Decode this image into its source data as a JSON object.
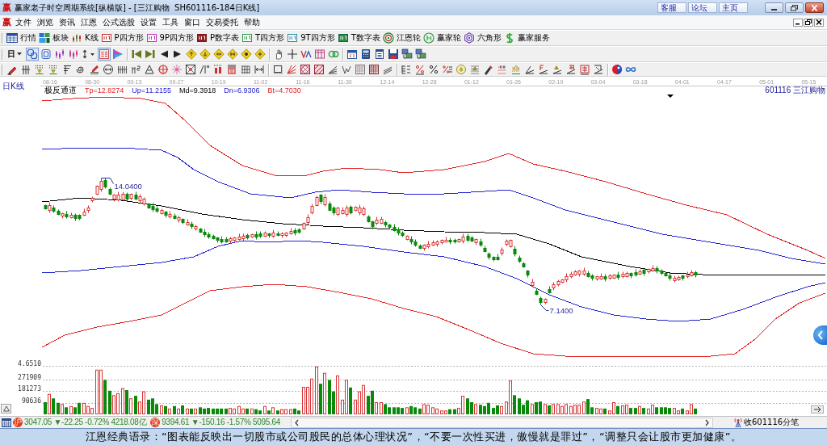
{
  "title_bar": {
    "logo": "赢",
    "title": "赢家老子时空周期系统[纵横版] - [三江购物  SH601116-184日K线]",
    "links": [
      "客服",
      "论坛",
      "主页"
    ]
  },
  "menu_bar": {
    "logo": "赢",
    "items": [
      "文件",
      "浏览",
      "资讯",
      "江恩",
      "公式选股",
      "设置",
      "工具",
      "窗口",
      "交易委托",
      "帮助"
    ]
  },
  "toolbar_1": {
    "items": [
      "行情",
      "板块",
      "K线",
      "P四方形",
      "9P四方形",
      "P数字表",
      "T四方形",
      "9T四方形",
      "T数字表",
      "江恩轮",
      "赢家轮",
      "六角形",
      "赢家服务"
    ]
  },
  "toolbar_2": {
    "period": "日",
    "buttons": [
      {
        "pressed": true
      },
      {
        "pressed": false
      },
      {
        "pressed": false
      },
      {
        "pressed": false
      },
      {
        "pressed": false
      },
      {
        "pressed": true
      },
      {
        "pressed": false
      },
      {
        "pressed": false
      },
      {
        "pressed": false
      },
      {
        "pressed": false
      },
      {
        "pressed": false
      },
      {
        "pressed": false
      },
      {
        "pressed": false
      },
      {
        "pressed": false
      },
      {
        "pressed": false
      },
      {
        "pressed": false
      },
      {
        "pressed": false
      },
      {
        "pressed": false
      },
      {
        "pressed": false
      },
      {
        "pressed": false
      },
      {
        "pressed": false
      },
      {
        "pressed": false
      },
      {
        "pressed": false
      },
      {
        "pressed": false
      },
      {
        "pressed": false
      },
      {
        "pressed": false
      },
      {
        "pressed": false
      },
      {
        "pressed": false
      }
    ]
  },
  "price_chart": {
    "period_label": "日K线",
    "dates": [
      "08-16",
      "08-30",
      "09-13",
      "09-27",
      "10-19",
      "11-02",
      "11-16",
      "11-30",
      "12-14",
      "12-28",
      "01-12",
      "01-26",
      "02-19",
      "03-04",
      "03-18",
      "04-01",
      "04-17",
      "05-01",
      "05-15"
    ],
    "indicator": {
      "name": "极反通道",
      "lines": [
        {
          "text": "Tp=12.8274",
          "color": "#e02020"
        },
        {
          "text": "Up=11.2155",
          "color": "#2020d0"
        },
        {
          "text": "Md=9.3918",
          "color": "#000000"
        },
        {
          "text": "Dn=6.9306",
          "color": "#2020d0"
        },
        {
          "text": "Bt=4.7030",
          "color": "#e02020"
        }
      ]
    },
    "stock_label": "601116 三江购物",
    "annotations": [
      {
        "kind": "high",
        "text": "14.0400"
      },
      {
        "kind": "low",
        "text": "7.1400"
      }
    ]
  },
  "volume_chart": {
    "top_label": "4.6510",
    "chart_data": {
      "type": "bar",
      "grid": true,
      "ylim": [
        0,
        382000
      ],
      "yticks": [
        90636,
        181273,
        271909
      ],
      "values": [
        95000,
        160000,
        125000,
        90000,
        80000,
        55000,
        65000,
        55000,
        90000,
        90000,
        65000,
        50000,
        350000,
        350000,
        270000,
        185000,
        150000,
        165000,
        205000,
        190000,
        125000,
        145000,
        100000,
        180000,
        115000,
        125000,
        80000,
        70000,
        65000,
        45000,
        65000,
        45000,
        70000,
        45000,
        45000,
        45000,
        55000,
        45000,
        50000,
        45000,
        45000,
        45000,
        45000,
        50000,
        45000,
        65000,
        45000,
        45000,
        45000,
        40000,
        30000,
        65000,
        30000,
        55000,
        30000,
        40000,
        40000,
        40000,
        45000,
        30000,
        215000,
        215000,
        280000,
        375000,
        240000,
        325000,
        270000,
        180000,
        305000,
        115000,
        270000,
        210000,
        115000,
        180000,
        230000,
        145000,
        185000,
        95000,
        95000,
        80000,
        55000,
        55000,
        55000,
        50000,
        55000,
        65000,
        55000,
        45000,
        80000,
        75000,
        55000,
        45000,
        30000,
        30000,
        40000,
        40000,
        50000,
        145000,
        125000,
        95000,
        80000,
        75000,
        65000,
        90000,
        50000,
        70000,
        65000,
        100000,
        265000,
        150000,
        125000,
        75000,
        110000,
        80000,
        95000,
        100000,
        80000,
        70000,
        80000,
        80000,
        65000,
        80000,
        65000,
        75000,
        75000,
        100000,
        120000,
        55000,
        50000,
        45000,
        45000,
        30000,
        95000,
        65000,
        70000,
        75000,
        50000,
        50000,
        65000,
        50000,
        45000,
        75000,
        55000,
        55000,
        55000,
        50000,
        50000,
        30000,
        45000,
        30000,
        80000,
        45000,
        null,
        null,
        null,
        null,
        null,
        null,
        null,
        null,
        null,
        null,
        null,
        null,
        null,
        null,
        null,
        null,
        null,
        null,
        null,
        null,
        null,
        null,
        null,
        null,
        null,
        null,
        null,
        null,
        null,
        null
      ]
    },
    "bars": [
      {
        "rising": false
      },
      {
        "rising": true
      },
      {
        "rising": false
      },
      {
        "rising": false
      },
      {
        "rising": true
      },
      {
        "rising": false
      },
      {
        "rising": true
      },
      {
        "rising": false
      },
      {
        "rising": false
      },
      {
        "rising": true
      },
      {
        "rising": true
      },
      {
        "rising": true
      },
      {
        "rising": true
      },
      {
        "rising": true
      },
      {
        "rising": false
      },
      {
        "rising": false
      },
      {
        "rising": true
      },
      {
        "rising": true
      },
      {
        "rising": true
      },
      {
        "rising": false
      },
      {
        "rising": true
      },
      {
        "rising": false
      },
      {
        "rising": true
      },
      {
        "rising": true
      },
      {
        "rising": false
      },
      {
        "rising": false
      },
      {
        "rising": false
      },
      {
        "rising": true
      },
      {
        "rising": false
      },
      {
        "rising": true
      },
      {
        "rising": false
      },
      {
        "rising": true
      },
      {
        "rising": false
      },
      {
        "rising": true
      },
      {
        "rising": false
      },
      {
        "rising": true
      },
      {
        "rising": false
      },
      {
        "rising": false
      },
      {
        "rising": false
      },
      {
        "rising": false
      },
      {
        "rising": false
      },
      {
        "rising": false
      },
      {
        "rising": false
      },
      {
        "rising": true
      },
      {
        "rising": true
      },
      {
        "rising": true
      },
      {
        "rising": true
      },
      {
        "rising": false
      },
      {
        "rising": true
      },
      {
        "rising": false
      },
      {
        "rising": false
      },
      {
        "rising": true
      },
      {
        "rising": false
      },
      {
        "rising": true
      },
      {
        "rising": false
      },
      {
        "rising": true
      },
      {
        "rising": true
      },
      {
        "rising": true
      },
      {
        "rising": false
      },
      {
        "rising": false
      },
      {
        "rising": true
      },
      {
        "rising": true
      },
      {
        "rising": true
      },
      {
        "rising": true
      },
      {
        "rising": false
      },
      {
        "rising": true
      },
      {
        "rising": false
      },
      {
        "rising": false
      },
      {
        "rising": true
      },
      {
        "rising": true
      },
      {
        "rising": true
      },
      {
        "rising": false
      },
      {
        "rising": true
      },
      {
        "rising": true
      },
      {
        "rising": true
      },
      {
        "rising": false
      },
      {
        "rising": false
      },
      {
        "rising": true
      },
      {
        "rising": true
      },
      {
        "rising": false
      },
      {
        "rising": false
      },
      {
        "rising": false
      },
      {
        "rising": false
      },
      {
        "rising": false
      },
      {
        "rising": true
      },
      {
        "rising": false
      },
      {
        "rising": false
      },
      {
        "rising": false
      },
      {
        "rising": true
      },
      {
        "rising": true
      },
      {
        "rising": true
      },
      {
        "rising": true
      },
      {
        "rising": true
      },
      {
        "rising": true
      },
      {
        "rising": false
      },
      {
        "rising": false
      },
      {
        "rising": true
      },
      {
        "rising": true
      },
      {
        "rising": false
      },
      {
        "rising": false
      },
      {
        "rising": true
      },
      {
        "rising": false
      },
      {
        "rising": false
      },
      {
        "rising": false
      },
      {
        "rising": false
      },
      {
        "rising": false
      },
      {
        "rising": true
      },
      {
        "rising": true
      },
      {
        "rising": true
      },
      {
        "rising": false
      },
      {
        "rising": false
      },
      {
        "rising": false
      },
      {
        "rising": false
      },
      {
        "rising": true
      },
      {
        "rising": false
      },
      {
        "rising": false
      },
      {
        "rising": true
      },
      {
        "rising": false
      },
      {
        "rising": true
      },
      {
        "rising": true
      },
      {
        "rising": true
      },
      {
        "rising": true
      },
      {
        "rising": true
      },
      {
        "rising": true
      },
      {
        "rising": true
      },
      {
        "rising": true
      },
      {
        "rising": false
      },
      {
        "rising": false
      },
      {
        "rising": true
      },
      {
        "rising": true
      },
      {
        "rising": false
      },
      {
        "rising": true
      },
      {
        "rising": true
      },
      {
        "rising": false
      },
      {
        "rising": true
      },
      {
        "rising": true
      },
      {
        "rising": false
      },
      {
        "rising": false
      },
      {
        "rising": true
      },
      {
        "rising": false
      },
      {
        "rising": true
      },
      {
        "rising": true
      },
      {
        "rising": false
      },
      {
        "rising": false
      },
      {
        "rising": false
      },
      {
        "rising": false
      },
      {
        "rising": true
      },
      {
        "rising": true
      },
      {
        "rising": false
      },
      {
        "rising": true
      },
      {
        "rising": true
      },
      {
        "rising": false
      }
    ]
  },
  "status_bar": {
    "markets": [
      {
        "badge": "沪",
        "text": "3047.05 ▼-22.25 -0.72% 4218.08亿"
      },
      {
        "badge": "深",
        "text": "9394.61 ▼-150.16 -1.57% 5095.64"
      }
    ],
    "feed_label": "收601116分笔"
  },
  "quote_bar": {
    "text": "江恩经典语录：“图表能反映出一切股市或公司股民的总体心理状况”，“不要一次性买进，傲慢就是罪过”，“调整只会让股市更加健康”。"
  }
}
